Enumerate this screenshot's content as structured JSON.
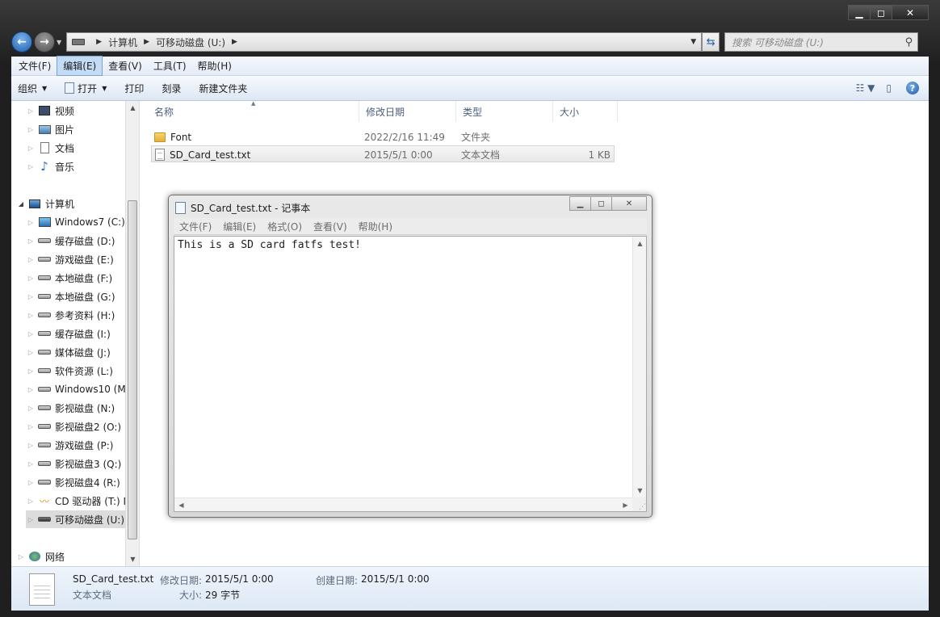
{
  "explorer": {
    "address": {
      "crumbs": [
        "计算机",
        "可移动磁盘 (U:)"
      ]
    },
    "search": {
      "placeholder": "搜索 可移动磁盘 (U:)"
    },
    "menu": [
      "文件(F)",
      "编辑(E)",
      "查看(V)",
      "工具(T)",
      "帮助(H)"
    ],
    "commands": {
      "organize": "组织",
      "open": "打开",
      "print": "打印",
      "burn": "刻录",
      "new_folder": "新建文件夹"
    },
    "nav": {
      "favorites": [
        {
          "label": "视频",
          "icon": "video-library-icon"
        },
        {
          "label": "图片",
          "icon": "pictures-library-icon"
        },
        {
          "label": "文档",
          "icon": "documents-library-icon"
        },
        {
          "label": "音乐",
          "icon": "music-library-icon"
        }
      ],
      "computer": "计算机",
      "drives": [
        "Windows7 (C:)",
        "缓存磁盘 (D:)",
        "游戏磁盘 (E:)",
        "本地磁盘 (F:)",
        "本地磁盘 (G:)",
        "参考资料 (H:)",
        "缓存磁盘 (I:)",
        "媒体磁盘 (J:)",
        "软件资源 (L:)",
        "Windows10 (M:",
        "影视磁盘 (N:)",
        "影视磁盘2 (O:)",
        "游戏磁盘 (P:)",
        "影视磁盘3 (Q:)",
        "影视磁盘4 (R:)",
        "CD 驱动器 (T:) M",
        "可移动磁盘 (U:)"
      ],
      "network": "网络"
    },
    "columns": [
      "名称",
      "修改日期",
      "类型",
      "大小"
    ],
    "files": [
      {
        "name": "Font",
        "modified": "2022/2/16 11:49",
        "type": "文件夹",
        "size": ""
      },
      {
        "name": "SD_Card_test.txt",
        "modified": "2015/5/1 0:00",
        "type": "文本文档",
        "size": "1 KB"
      }
    ],
    "details": {
      "name": "SD_Card_test.txt",
      "type": "文本文档",
      "modified_label": "修改日期:",
      "modified": "2015/5/1 0:00",
      "created_label": "创建日期:",
      "created": "2015/5/1 0:00",
      "size_label": "大小:",
      "size": "29 字节"
    }
  },
  "notepad": {
    "title": "SD_Card_test.txt - 记事本",
    "menu": [
      "文件(F)",
      "编辑(E)",
      "格式(O)",
      "查看(V)",
      "帮助(H)"
    ],
    "content": "This is a SD card fatfs test!"
  }
}
